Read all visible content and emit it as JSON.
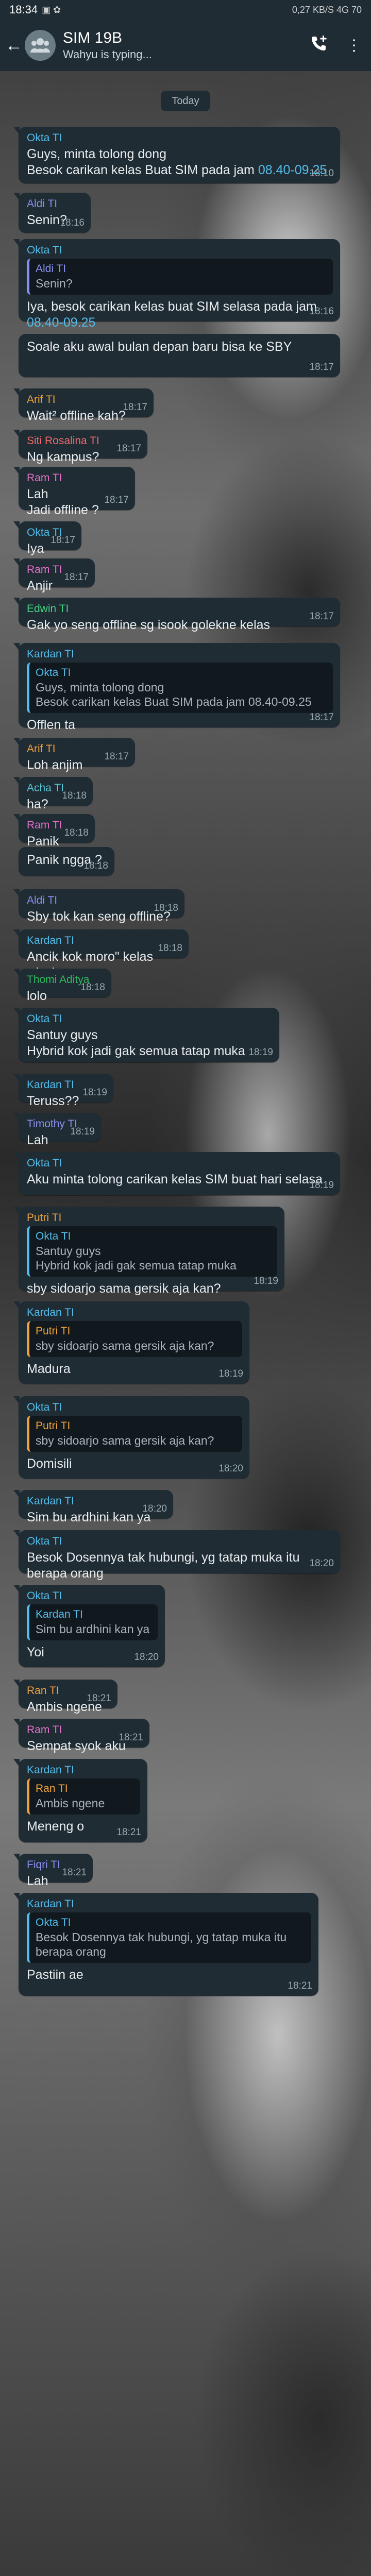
{
  "status": {
    "time": "18:34",
    "right": "0,27 KB/S 4G 70"
  },
  "header": {
    "title": "SIM 19B",
    "subtitle": "Wahyu is typing..."
  },
  "date_chip": "Today",
  "colors": {
    "okta": "#53bdeb",
    "aldi": "#8b8ff0",
    "arif": "#f0a13c",
    "siti": "#ef6b6b",
    "ram": "#e570c9",
    "edwin": "#43d17f",
    "kardan": "#53bdeb",
    "acha": "#57c4d6",
    "thomi": "#2fb85d",
    "timothy": "#8b8ff0",
    "putri": "#f0a13c",
    "ran": "#f0a13c",
    "fiqri": "#8b8ff0"
  },
  "messages": [
    {
      "sender": "Okta TI",
      "text": "Guys, minta tolong dong\nBesok carikan kelas Buat SIM pada jam ",
      "link": "08.40-09.25",
      "time": "18:10"
    },
    {
      "sender": "Aldi TI",
      "text": "Senin?",
      "time": "18:16"
    },
    {
      "sender": "Okta TI",
      "quote_sender": "Aldi TI",
      "quote_text": "Senin?",
      "text": "Iya, besok carikan kelas buat SIM selasa pada jam ",
      "link": "08.40-09.25",
      "time": "18:16"
    },
    {
      "sender": "",
      "text": "Soale aku awal bulan depan baru bisa ke SBY",
      "time": "18:17"
    },
    {
      "sender": "Arif TI",
      "text": "Wait² offline kah?",
      "time": "18:17"
    },
    {
      "sender": "Siti Rosalina TI",
      "text": "Ng kampus?",
      "time": "18:17"
    },
    {
      "sender": "Ram TI",
      "text": "Lah\nJadi offline ?",
      "time": "18:17"
    },
    {
      "sender": "Okta TI",
      "text": "Iya",
      "time": "18:17"
    },
    {
      "sender": "Ram TI",
      "text": "Anjir",
      "time": "18:17"
    },
    {
      "sender": "Edwin TI",
      "text": "Gak yo seng offline sg isook golekne kelas",
      "time": "18:17"
    },
    {
      "sender": "Kardan TI",
      "quote_sender": "Okta TI",
      "quote_text": "Guys, minta tolong dong\nBesok carikan kelas Buat SIM pada jam 08.40-09.25",
      "text": "Offlen ta",
      "time": "18:17"
    },
    {
      "sender": "Arif TI",
      "text": "Loh anjim",
      "time": "18:17"
    },
    {
      "sender": "Acha TI",
      "text": "ha?",
      "time": "18:18"
    },
    {
      "sender": "Ram TI",
      "text": "Panik",
      "time": "18:18"
    },
    {
      "sender": "",
      "text": "Panik ngga ?",
      "time": "18:18"
    },
    {
      "sender": "Aldi TI",
      "text": "Sby tok kan seng offline?",
      "time": "18:18"
    },
    {
      "sender": "Kardan TI",
      "text": "Ancik kok moro\" kelas wkwk",
      "time": "18:18"
    },
    {
      "sender": "Thomi Aditya",
      "text": "lolo",
      "time": "18:18"
    },
    {
      "sender": "Okta TI",
      "text": "Santuy guys\nHybrid kok jadi gak semua tatap muka",
      "time": "18:19"
    },
    {
      "sender": "Kardan TI",
      "text": "Teruss??",
      "time": "18:19"
    },
    {
      "sender": "Timothy TI",
      "text": "Lah",
      "time": "18:19"
    },
    {
      "sender": "Okta TI",
      "text": "Aku minta tolong carikan kelas SIM buat hari selasa",
      "time": "18:19"
    },
    {
      "sender": "Putri TI",
      "quote_sender": "Okta TI",
      "quote_text": "Santuy guys\nHybrid kok jadi gak semua tatap muka",
      "text": "sby sidoarjo sama gersik aja kan?",
      "time": "18:19"
    },
    {
      "sender": "Kardan TI",
      "quote_sender": "Putri TI",
      "quote_text": "sby sidoarjo sama gersik aja kan?",
      "text": "Madura",
      "time": "18:19"
    },
    {
      "sender": "Okta TI",
      "quote_sender": "Putri TI",
      "quote_text": "sby sidoarjo sama gersik aja kan?",
      "text": "Domisili",
      "time": "18:20"
    },
    {
      "sender": "Kardan TI",
      "text": "Sim bu ardhini kan ya",
      "time": "18:20"
    },
    {
      "sender": "Okta TI",
      "text": "Besok Dosennya tak hubungi, yg tatap muka itu berapa orang",
      "time": "18:20"
    },
    {
      "sender": "Okta TI",
      "quote_sender": "Kardan TI",
      "quote_text": "Sim bu ardhini kan ya",
      "text": "Yoi",
      "time": "18:20"
    },
    {
      "sender": "Ran TI",
      "text": "Ambis ngene",
      "time": "18:21"
    },
    {
      "sender": "Ram TI",
      "text": "Sempat syok aku",
      "time": "18:21"
    },
    {
      "sender": "Kardan TI",
      "quote_sender": "Ran TI",
      "quote_text": "Ambis ngene",
      "text": "Meneng o",
      "time": "18:21"
    },
    {
      "sender": "Fiqri TI",
      "text": "Lah",
      "time": "18:21"
    },
    {
      "sender": "Kardan TI",
      "quote_sender": "Okta TI",
      "quote_text": "Besok Dosennya tak hubungi, yg tatap muka itu berapa orang",
      "text": "Pastiin ae",
      "time": "18:21"
    }
  ]
}
